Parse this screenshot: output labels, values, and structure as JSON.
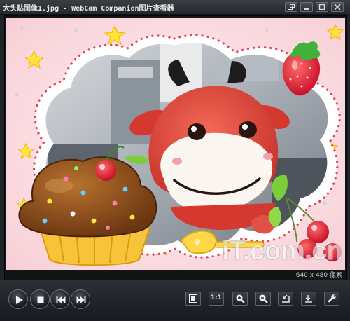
{
  "window": {
    "title": "大头贴图像1.jpg - WebCam Companion图片查看器",
    "controls": [
      "restore-down-icon",
      "minimize-icon",
      "maximize-icon",
      "close-icon"
    ]
  },
  "image": {
    "resolution_label": "640 x 480 像素",
    "watermark": "iT.com.cn",
    "colors": {
      "background": "#fbe1e4",
      "frame": "#ffffff",
      "dots": "#e0425a",
      "cow": "#e0463c",
      "cupcake": "#8a4a1a"
    }
  },
  "toolbar": {
    "one_to_one_label": "1:1",
    "icons": [
      "play-icon",
      "stop-icon",
      "previous-icon",
      "next-icon",
      "fit-to-window-icon",
      "actual-size-icon",
      "zoom-in-icon",
      "zoom-out-icon",
      "rotate-left-icon",
      "rotate-right-icon",
      "settings-icon"
    ]
  }
}
